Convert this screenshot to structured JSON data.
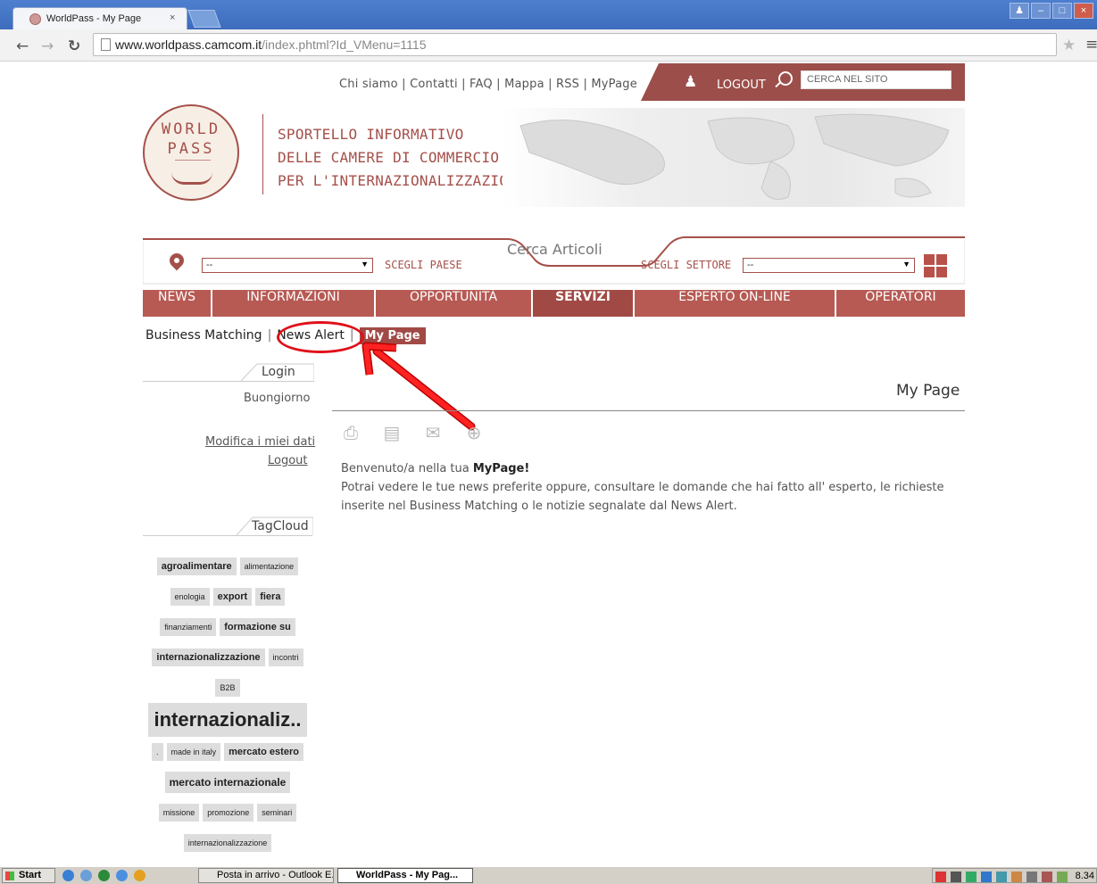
{
  "browser": {
    "tab_title": "WorldPass - My Page",
    "tab_close": "×",
    "url_host": "www.worldpass.camcom.it",
    "url_path": "/index.phtml?Id_VMenu=1115"
  },
  "header": {
    "top_links": "Chi siamo | Contatti | FAQ | Mappa | RSS | MyPage",
    "logout": "LOGOUT",
    "search_placeholder": "CERCA NEL SITO",
    "logo_line1": "WORLD",
    "logo_line2": "PASS",
    "tagline": [
      "SPORTELLO INFORMATIVO",
      "DELLE CAMERE DI COMMERCIO",
      "PER L'INTERNAZIONALIZZAZIONE"
    ]
  },
  "search_bar": {
    "title": "Cerca Articoli",
    "country_value": "--",
    "country_label": "SCEGLI PAESE",
    "sector_label": "SCEGLI SETTORE",
    "sector_value": "--"
  },
  "main_nav": [
    "NEWS",
    "INFORMAZIONI",
    "OPPORTUNITÀ",
    "SERVIZI",
    "ESPERTO ON-LINE",
    "OPERATORI"
  ],
  "sub_nav": {
    "business_matching": "Business Matching",
    "news_alert": "News Alert",
    "my_page": "My Page",
    "sep": "|"
  },
  "sidebar": {
    "login_tab": "Login",
    "greeting": "Buongiorno",
    "edit_link": "Modifica i miei dati",
    "logout_link": "Logout",
    "tagcloud_tab": "TagCloud"
  },
  "tags": {
    "t1": "agroalimentare",
    "t2": "alimentazione",
    "t3": "enologia",
    "t4": "export",
    "t5": "fiera",
    "t6": "finanziamenti",
    "t7": "formazione su",
    "t8": "internazionalizzazione",
    "t9": "incontri",
    "t10": "B2B",
    "t11": "internazionaliz..",
    "t12": ".",
    "t13": "made in italy",
    "t14": "mercato estero",
    "t15": "mercato internazionale",
    "t16": "missione",
    "t17": "promozione",
    "t18": "seminari",
    "t19": "internazionalizzazione"
  },
  "content": {
    "title": "My Page",
    "welcome_prefix": "Benvenuto/a nella tua ",
    "welcome_bold": "MyPage!",
    "body": "Potrai vedere le tue news preferite oppure, consultare le domande che hai fatto all' esperto, le richieste inserite nel Business Matching o le notizie segnalate dal News Alert."
  },
  "taskbar": {
    "start": "Start",
    "task1": "Posta in arrivo - Outlook E...",
    "task2": "WorldPass - My Pag...",
    "clock": "8.34"
  }
}
